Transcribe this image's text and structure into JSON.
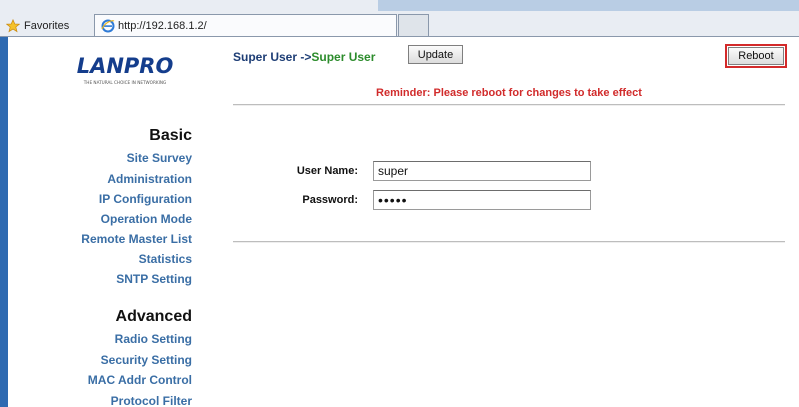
{
  "browser": {
    "favorites_label": "Favorites",
    "tab_url": "http://192.168.1.2/"
  },
  "sidebar": {
    "logo": "LANPRO",
    "logo_tagline": "THE NATURAL CHOICE IN NETWORKING",
    "basic_heading": "Basic",
    "basic_items": [
      "Site Survey",
      "Administration",
      "IP Configuration",
      "Operation Mode",
      "Remote Master List",
      "Statistics",
      "SNTP Setting"
    ],
    "advanced_heading": "Advanced",
    "advanced_items": [
      "Radio Setting",
      "Security Setting",
      "MAC Addr Control",
      "Protocol Filter"
    ]
  },
  "main": {
    "breadcrumb_root": "Super User ->",
    "breadcrumb_current": "Super User",
    "update_label": "Update",
    "reboot_label": "Reboot",
    "reminder": "Reminder: Please reboot for changes to take effect",
    "username_label": "User Name:",
    "username_value": "super",
    "password_label": "Password:",
    "password_value": "•••••"
  },
  "colors": {
    "reboot_highlight": "#d32a2a",
    "link": "#3a6ea5",
    "reminder": "#d12b2b"
  }
}
